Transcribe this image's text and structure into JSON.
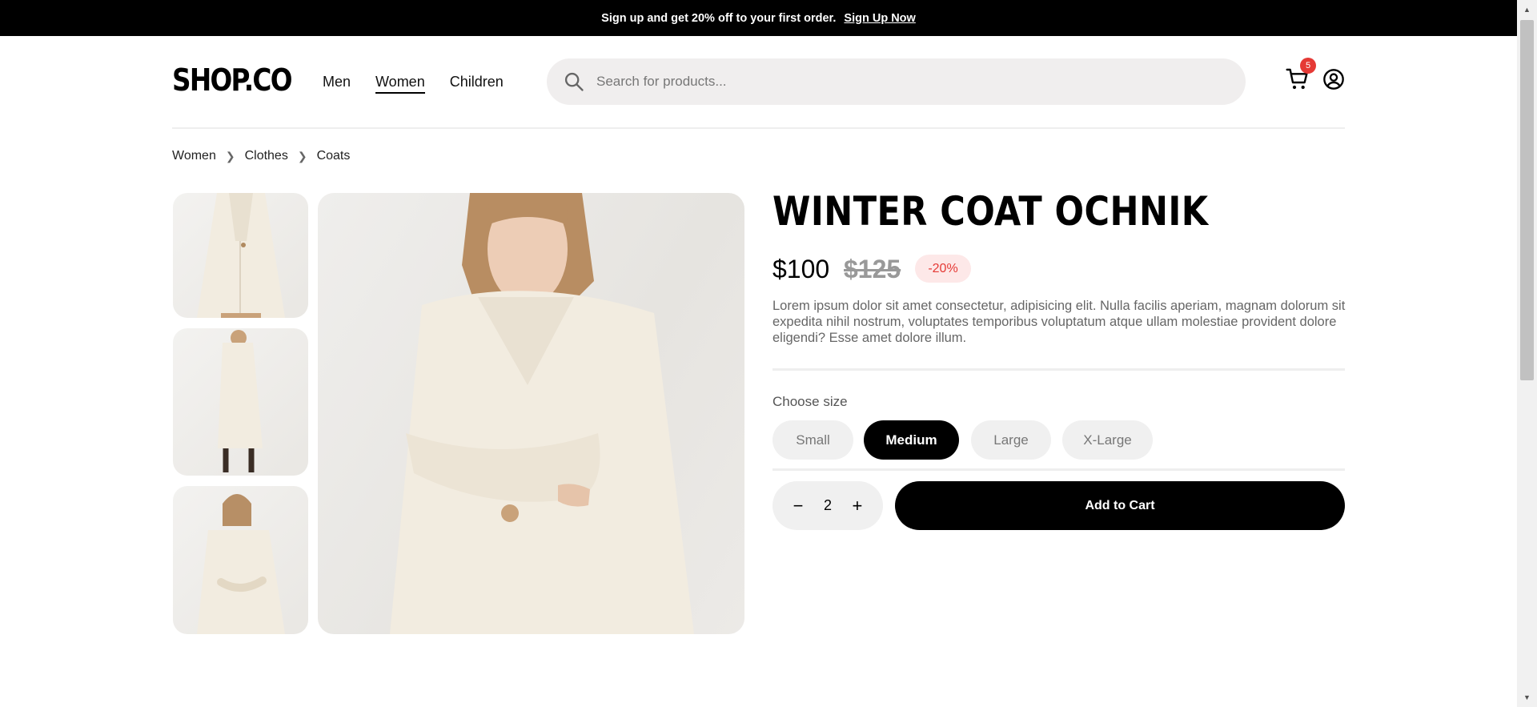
{
  "promo": {
    "text": "Sign up and get 20% off to your first order.",
    "link": "Sign Up Now"
  },
  "header": {
    "logo": "SHOP.CO",
    "nav": [
      {
        "label": "Men",
        "active": false
      },
      {
        "label": "Women",
        "active": true
      },
      {
        "label": "Children",
        "active": false
      }
    ],
    "search_placeholder": "Search for products...",
    "cart_count": "5",
    "icons": [
      "search-icon",
      "cart-icon",
      "user-icon"
    ]
  },
  "breadcrumb": [
    "Women",
    "Clothes",
    "Coats"
  ],
  "product": {
    "title": "WINTER COAT OCHNIK",
    "price": "$100",
    "old_price": "$125",
    "discount": "-20%",
    "description": "Lorem ipsum dolor sit amet consectetur, adipisicing elit. Nulla facilis aperiam, magnam dolorum sit expedita nihil nostrum, voluptates temporibus voluptatum atque ullam molestiae provident dolore eligendi? Esse amet dolore illum.",
    "size_label": "Choose size",
    "sizes": [
      "Small",
      "Medium",
      "Large",
      "X-Large"
    ],
    "selected_size": "Medium",
    "quantity": "2",
    "add_to_cart": "Add to Cart"
  },
  "colors": {
    "accent": "#000000",
    "badge": "#e53935",
    "discount_bg": "#fde8e8",
    "coat": "#f2ece0"
  }
}
